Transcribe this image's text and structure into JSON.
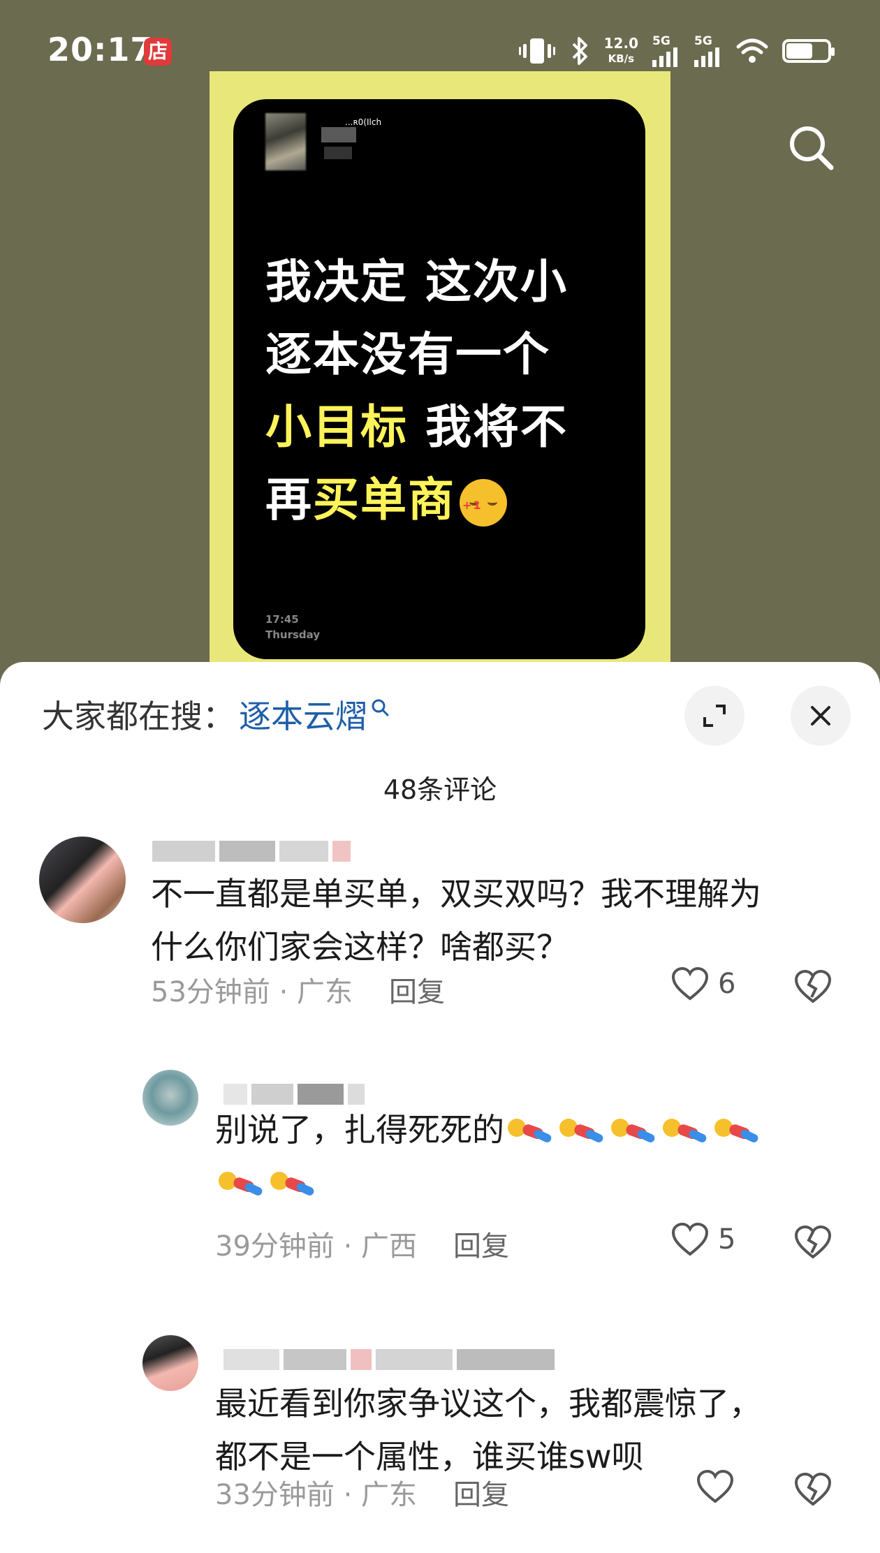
{
  "status_bar": {
    "time": "20:17",
    "shop_badge": "店",
    "net_speed_value": "12.0",
    "net_speed_unit": "KB/s",
    "signal1": "5G",
    "signal2": "5G",
    "icons": [
      "vibrate-icon",
      "bluetooth-icon",
      "signal-icon",
      "signal-icon",
      "wifi-icon",
      "battery-icon"
    ]
  },
  "poster": {
    "handle": "...ʀ0(Ilch",
    "line1": "我决定 这次小",
    "line2": "逐本没有一个",
    "line3_highlight": "小目标",
    "line3_rest": " 我将不",
    "line4_normal": "再",
    "line4_highlight": "买单商",
    "emoji_plus": "+1",
    "time": "17:45",
    "day": "Thursday"
  },
  "sheet": {
    "hot_search_label": "大家都在搜：",
    "hot_search_term": "逐本云熠",
    "comment_count_title": "48条评论"
  },
  "comments": [
    {
      "text_line1": "不一直都是单买单，双买双吗？我不理解为",
      "text_line2": "什么你们家会这样？啥都买？",
      "time_location": "53分钟前 · 广东",
      "reply_label": "回复",
      "likes": "6"
    },
    {
      "text": "别说了，扎得死死的",
      "emoji_count_line1": 5,
      "emoji_count_line2": 2,
      "time_location": "39分钟前 · 广西",
      "reply_label": "回复",
      "likes": "5"
    },
    {
      "text_line1": "最近看到你家争议这个，我都震惊了，",
      "text_line2": "都不是一个属性，谁买谁sw呗",
      "time_location": "33分钟前 · 广东",
      "reply_label": "回复",
      "likes": ""
    }
  ],
  "colors": {
    "background": "#6b6b4f",
    "poster_frame": "#e8e87a",
    "highlight_text": "#fff35a",
    "search_term": "#1e5ea8"
  }
}
